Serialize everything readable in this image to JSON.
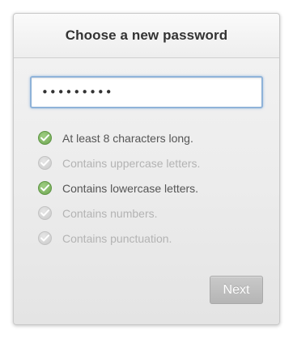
{
  "dialog": {
    "title": "Choose a new password"
  },
  "password": {
    "value": "•••••••••"
  },
  "rules": [
    {
      "label": "At least 8 characters long.",
      "met": true
    },
    {
      "label": "Contains uppercase letters.",
      "met": false
    },
    {
      "label": "Contains lowercase letters.",
      "met": true
    },
    {
      "label": "Contains numbers.",
      "met": false
    },
    {
      "label": "Contains punctuation.",
      "met": false
    }
  ],
  "actions": {
    "next_label": "Next"
  },
  "colors": {
    "met_check": "#7ab15c",
    "unmet_check": "#d2d2d2",
    "field_focus": "#8fb3d9"
  },
  "icons": {
    "met": "check-circle-icon",
    "unmet": "check-circle-disabled-icon"
  }
}
